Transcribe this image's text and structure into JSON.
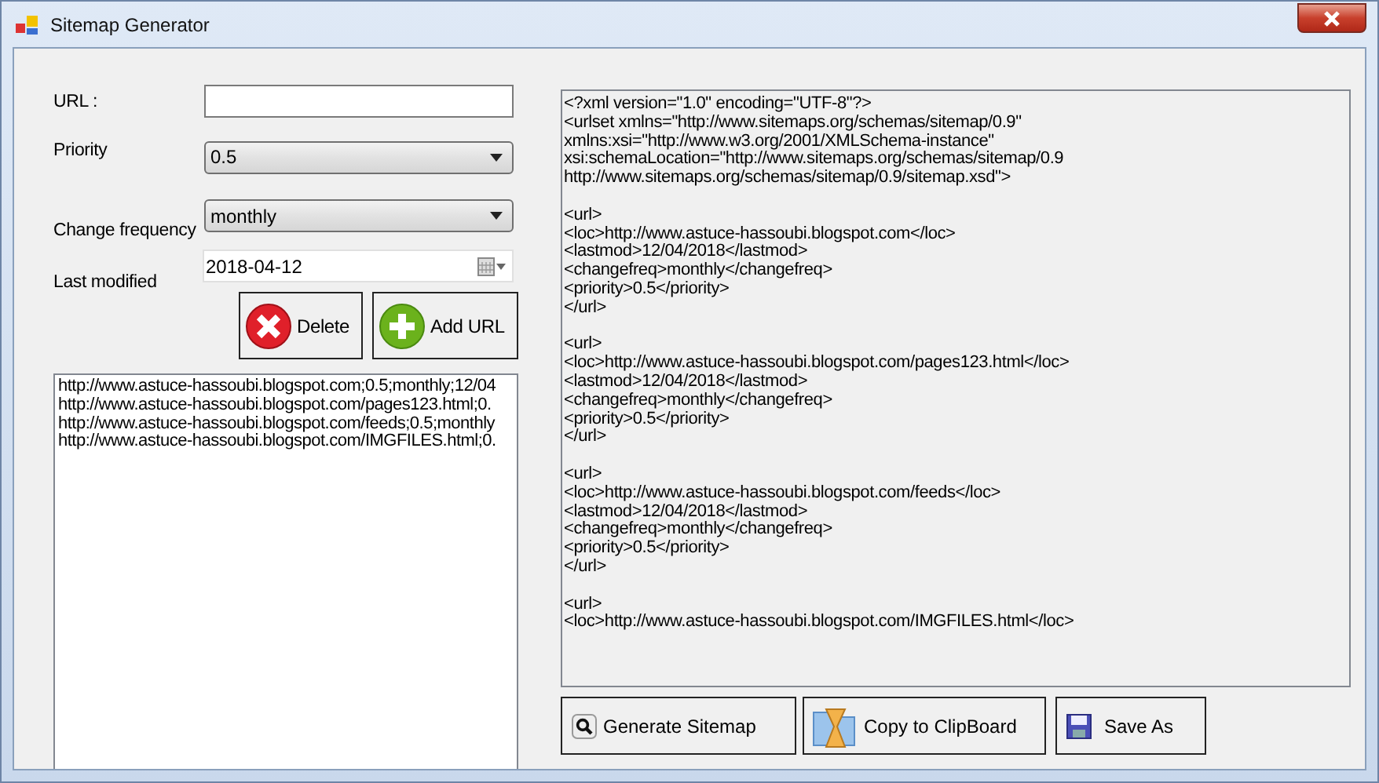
{
  "window": {
    "title": "Sitemap Generator"
  },
  "form": {
    "url": {
      "label": "URL :"
    },
    "priority": {
      "label": "Priority",
      "value": "0.5"
    },
    "change_frequency": {
      "label": "Change frequency",
      "value": "monthly"
    },
    "last_modified": {
      "label": "Last modified",
      "value": "2018-04-12"
    }
  },
  "buttons": [
    {
      "kind": "delete",
      "label": "Delete"
    },
    {
      "kind": "add",
      "label": "Add URL"
    }
  ],
  "url_list": [
    "http://www.astuce-hassoubi.blogspot.com;0.5;monthly;12/04",
    "http://www.astuce-hassoubi.blogspot.com/pages123.html;0.",
    "http://www.astuce-hassoubi.blogspot.com/feeds;0.5;monthly",
    "http://www.astuce-hassoubi.blogspot.com/IMGFILES.html;0."
  ],
  "xml_output": [
    [
      "<?xml version=\"1.0\" encoding=\"UTF-8\"?>",
      "<urlset xmlns=\"http://www.sitemaps.org/schemas/sitemap/0.9\"",
      "xmlns:xsi=\"http://www.w3.org/2001/XMLSchema-instance\"",
      "xsi:schemaLocation=\"http://www.sitemaps.org/schemas/sitemap/0.9",
      "http://www.sitemaps.org/schemas/sitemap/0.9/sitemap.xsd\">"
    ],
    [
      "<url>",
      "<loc>http://www.astuce-hassoubi.blogspot.com</loc>",
      "<lastmod>12/04/2018</lastmod>",
      "<changefreq>monthly</changefreq>",
      "<priority>0.5</priority>",
      "</url>"
    ],
    [
      "<url>",
      "<loc>http://www.astuce-hassoubi.blogspot.com/pages123.html</loc>",
      "<lastmod>12/04/2018</lastmod>",
      "<changefreq>monthly</changefreq>",
      "<priority>0.5</priority>",
      "</url>"
    ],
    [
      "<url>",
      "<loc>http://www.astuce-hassoubi.blogspot.com/feeds</loc>",
      "<lastmod>12/04/2018</lastmod>",
      "<changefreq>monthly</changefreq>",
      "<priority>0.5</priority>",
      "</url>"
    ],
    [
      "<url>",
      "<loc>http://www.astuce-hassoubi.blogspot.com/IMGFILES.html</loc>"
    ]
  ],
  "actions": [
    {
      "kind": "generate",
      "label": "Generate Sitemap"
    },
    {
      "kind": "copy",
      "label": "Copy to ClipBoard"
    },
    {
      "kind": "save",
      "label": "Save As"
    }
  ]
}
